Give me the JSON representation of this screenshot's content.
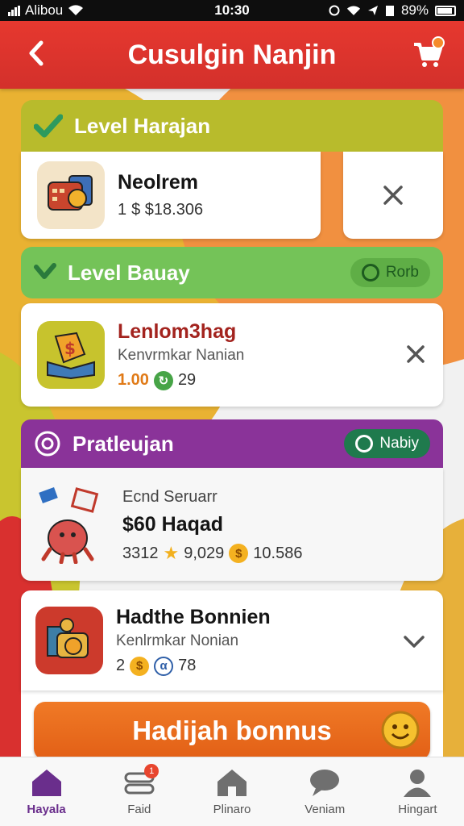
{
  "status_bar": {
    "carrier": "Alibou",
    "time": "10:30",
    "battery": "89%"
  },
  "header": {
    "title": "Cusulgin Nanjin"
  },
  "sections": [
    {
      "title": "Level Harajan",
      "item": {
        "name": "Neolrem",
        "meta_prefix": "1",
        "meta_value": "$ $18.306"
      }
    },
    {
      "title": "Level Bauay",
      "pill": "Rorb",
      "item": {
        "name": "Lenlom3hag",
        "subtitle": "Kenvrmkar Nanian",
        "meta_a": "1.00",
        "meta_b": "29"
      }
    },
    {
      "title": "Pratleujan",
      "pill": "Nabiy",
      "item": {
        "label": "Ecnd Seruarr",
        "name": "$60 Haqad",
        "meta_a": "3312",
        "meta_b": "9,029",
        "meta_c": "10.586"
      }
    },
    {
      "title": "",
      "item": {
        "name": "Hadthe Bonnien",
        "subtitle": "Kenlrmkar Nonian",
        "meta_a": "2",
        "meta_b": "78"
      }
    }
  ],
  "bonus_button": "Hadijah bonnus",
  "tabbar": {
    "tabs": [
      {
        "label": "Hayala",
        "icon": "home-icon"
      },
      {
        "label": "Faid",
        "icon": "ticket-icon",
        "badge": "1"
      },
      {
        "label": "Plinaro",
        "icon": "store-icon"
      },
      {
        "label": "Veniam",
        "icon": "chat-icon"
      },
      {
        "label": "Hingart",
        "icon": "profile-icon"
      }
    ]
  },
  "colors": {
    "header": "#e6382f",
    "section_yellow": "#b8bb2c",
    "section_green": "#74c358",
    "section_purple": "#8a3399",
    "bonus": "#f07a26",
    "tab_active": "#6a2e8c"
  }
}
